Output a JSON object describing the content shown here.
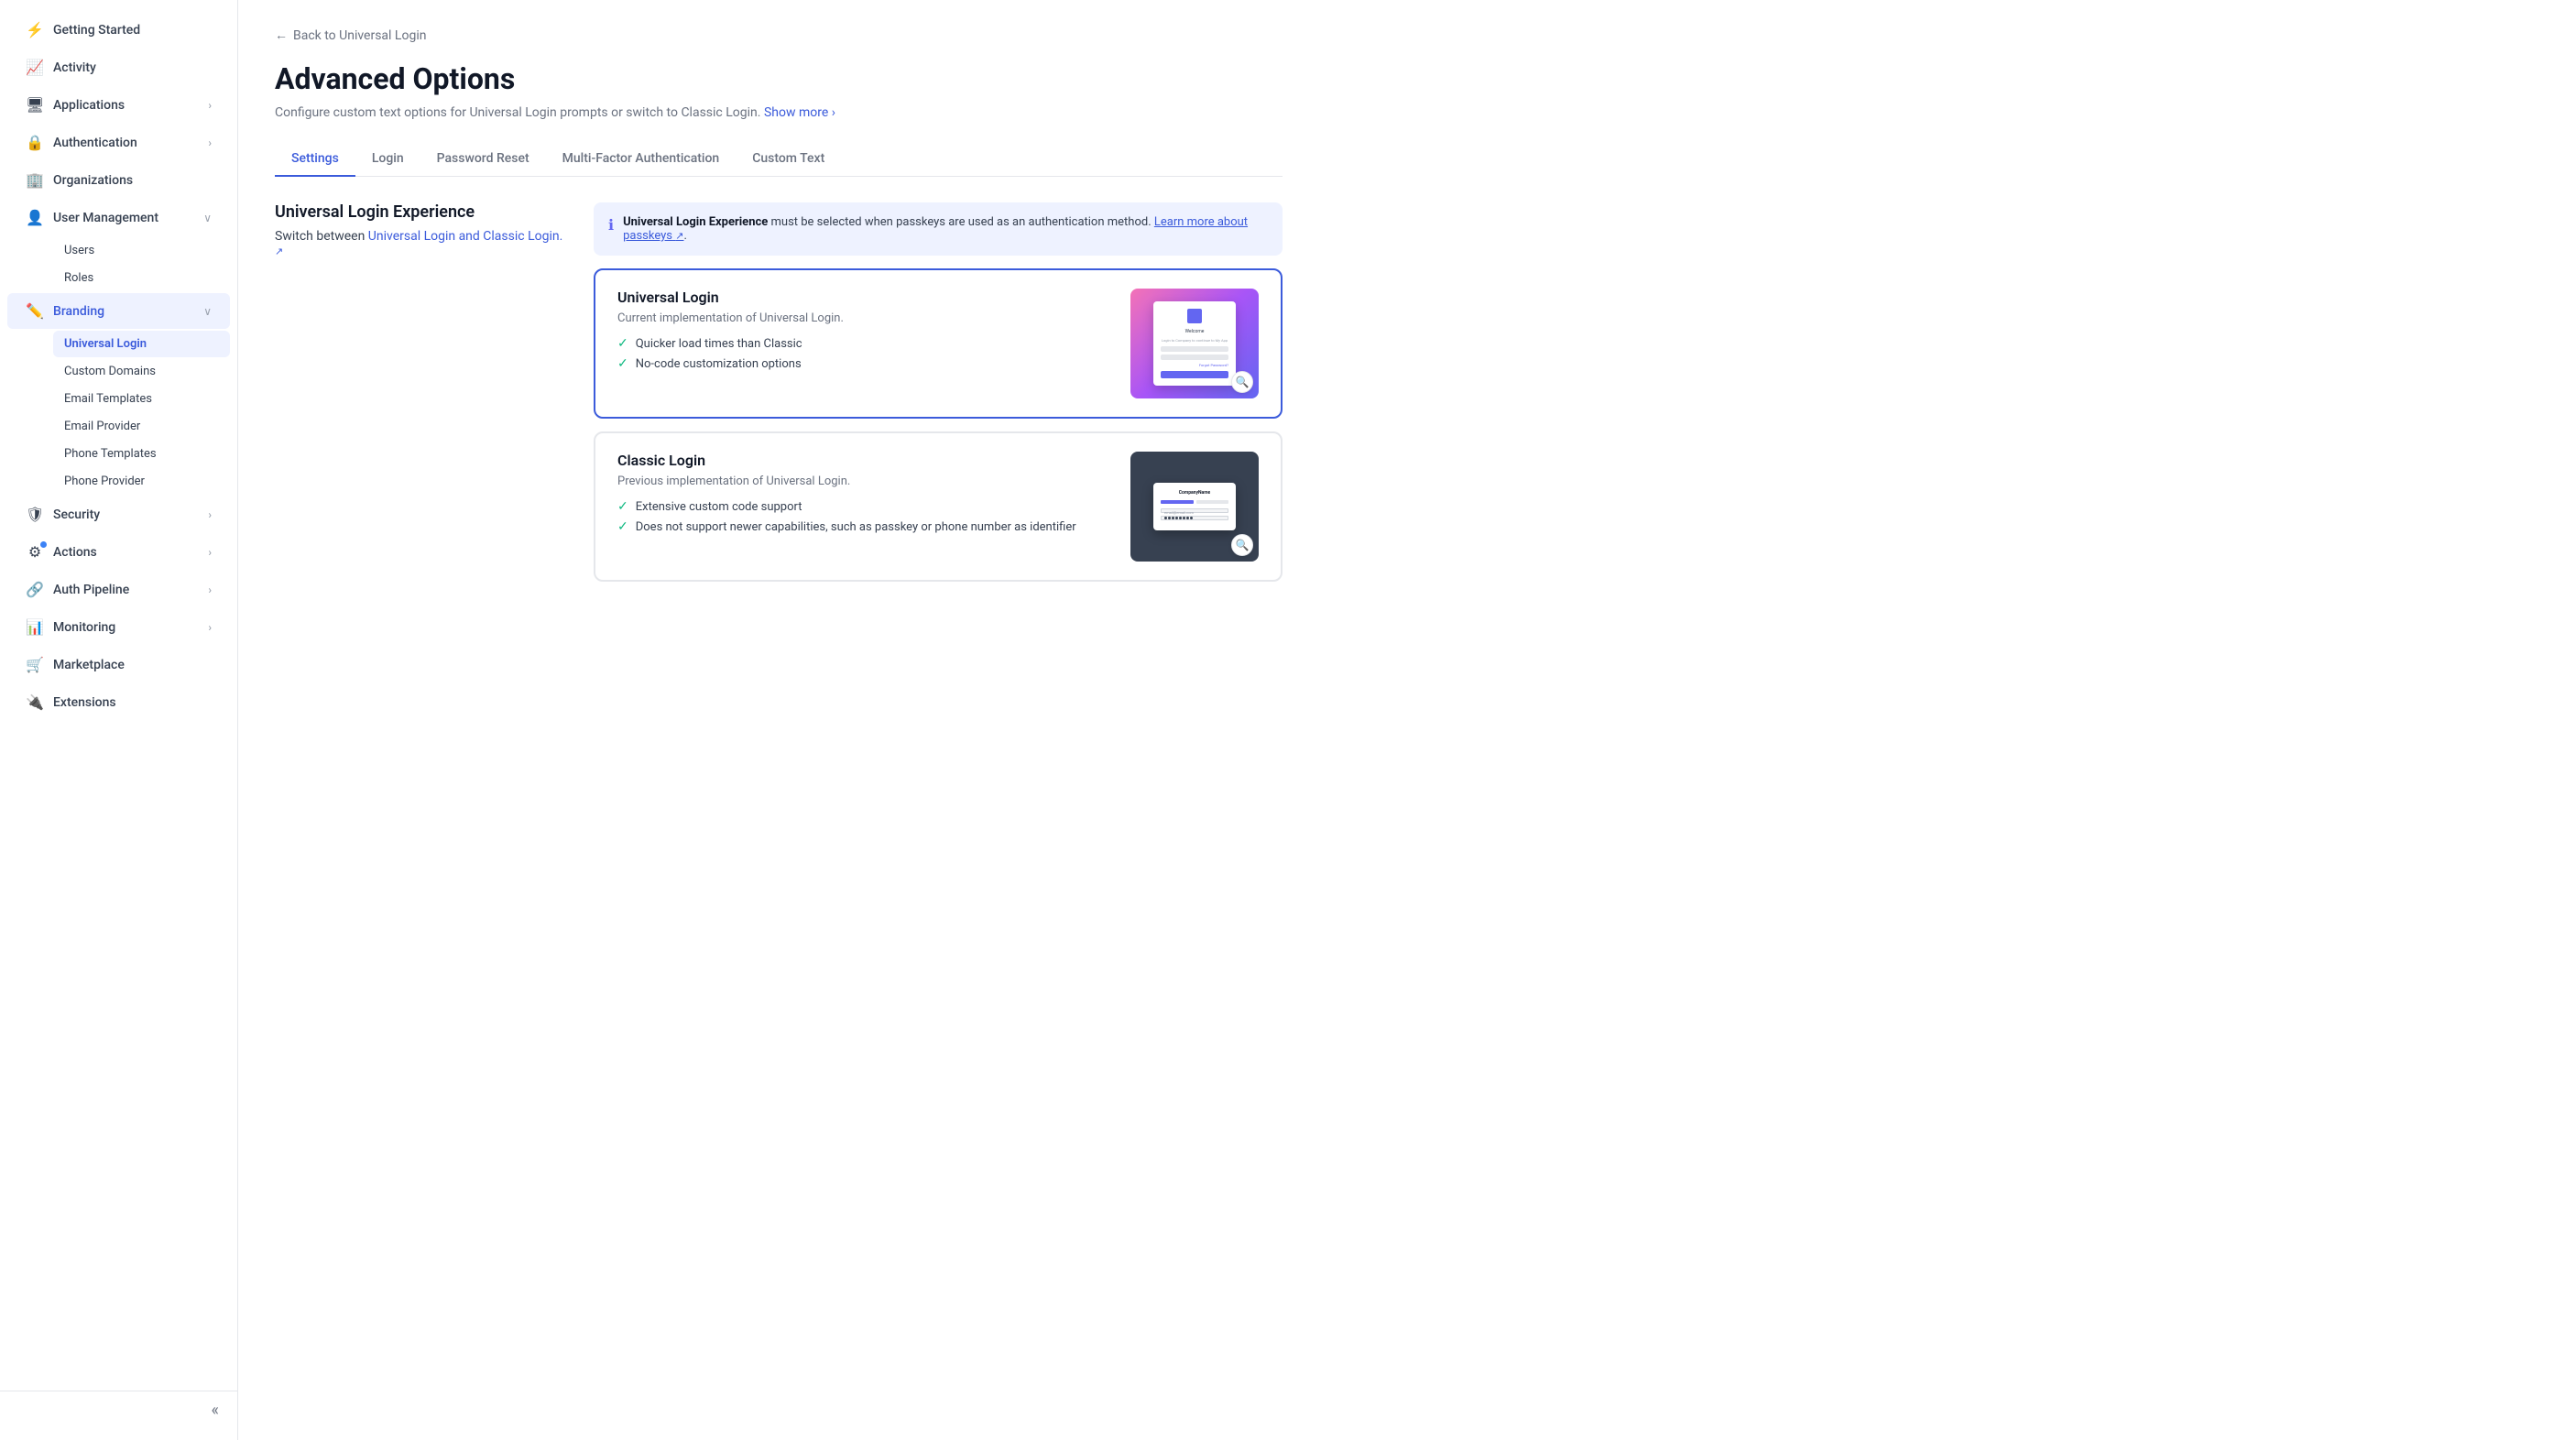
{
  "sidebar": {
    "items": [
      {
        "id": "getting-started",
        "label": "Getting Started",
        "icon": "⚡",
        "hasChevron": false,
        "active": false
      },
      {
        "id": "activity",
        "label": "Activity",
        "icon": "📈",
        "hasChevron": false,
        "active": false
      },
      {
        "id": "applications",
        "label": "Applications",
        "icon": "🖥",
        "hasChevron": true,
        "active": false
      },
      {
        "id": "authentication",
        "label": "Authentication",
        "icon": "🔒",
        "hasChevron": true,
        "active": false
      },
      {
        "id": "organizations",
        "label": "Organizations",
        "icon": "🏢",
        "hasChevron": false,
        "active": false
      },
      {
        "id": "user-management",
        "label": "User Management",
        "icon": "👤",
        "hasChevron": true,
        "active": false,
        "expanded": true
      },
      {
        "id": "branding",
        "label": "Branding",
        "icon": "✏️",
        "hasChevron": true,
        "active": true,
        "expanded": true
      },
      {
        "id": "security",
        "label": "Security",
        "icon": "🛡",
        "hasChevron": true,
        "active": false
      },
      {
        "id": "actions",
        "label": "Actions",
        "icon": "⚙",
        "hasChevron": true,
        "active": false,
        "hasDot": true
      },
      {
        "id": "auth-pipeline",
        "label": "Auth Pipeline",
        "icon": "🔗",
        "hasChevron": true,
        "active": false
      },
      {
        "id": "monitoring",
        "label": "Monitoring",
        "icon": "📊",
        "hasChevron": true,
        "active": false
      },
      {
        "id": "marketplace",
        "label": "Marketplace",
        "icon": "🛒",
        "hasChevron": false,
        "active": false
      },
      {
        "id": "extensions",
        "label": "Extensions",
        "icon": "🔌",
        "hasChevron": false,
        "active": false
      }
    ],
    "user_management_sub": [
      {
        "id": "users",
        "label": "Users",
        "active": false
      },
      {
        "id": "roles",
        "label": "Roles",
        "active": false
      }
    ],
    "branding_sub": [
      {
        "id": "universal-login",
        "label": "Universal Login",
        "active": true
      },
      {
        "id": "custom-domains",
        "label": "Custom Domains",
        "active": false
      },
      {
        "id": "email-templates",
        "label": "Email Templates",
        "active": false
      },
      {
        "id": "email-provider",
        "label": "Email Provider",
        "active": false
      },
      {
        "id": "phone-templates",
        "label": "Phone Templates",
        "active": false
      },
      {
        "id": "phone-provider",
        "label": "Phone Provider",
        "active": false
      }
    ],
    "collapse_label": "«"
  },
  "header": {
    "back_label": "Back to Universal Login",
    "title": "Advanced Options",
    "description": "Configure custom text options for Universal Login prompts or switch to Classic Login.",
    "show_more_label": "Show more"
  },
  "tabs": [
    {
      "id": "settings",
      "label": "Settings",
      "active": true
    },
    {
      "id": "login",
      "label": "Login",
      "active": false
    },
    {
      "id": "password-reset",
      "label": "Password Reset",
      "active": false
    },
    {
      "id": "mfa",
      "label": "Multi-Factor Authentication",
      "active": false
    },
    {
      "id": "custom-text",
      "label": "Custom Text",
      "active": false
    }
  ],
  "section": {
    "title": "Universal Login Experience",
    "description_prefix": "Switch between ",
    "description_link": "Universal Login and Classic Login.",
    "info_banner": {
      "text_bold": "Universal Login Experience",
      "text_after": " must be selected when passkeys are used as an authentication method. ",
      "learn_more_label": "Learn more about passkeys",
      "text_end": "."
    },
    "cards": [
      {
        "id": "universal-login",
        "title": "Universal Login",
        "description": "Current implementation of Universal Login.",
        "features": [
          "Quicker load times than Classic",
          "No-code customization options"
        ],
        "selected": true,
        "type": "universal"
      },
      {
        "id": "classic-login",
        "title": "Classic Login",
        "description": "Previous implementation of Universal Login.",
        "features": [
          "Extensive custom code support",
          "Does not support newer capabilities, such as passkey or phone number as identifier"
        ],
        "selected": false,
        "type": "classic"
      }
    ]
  }
}
